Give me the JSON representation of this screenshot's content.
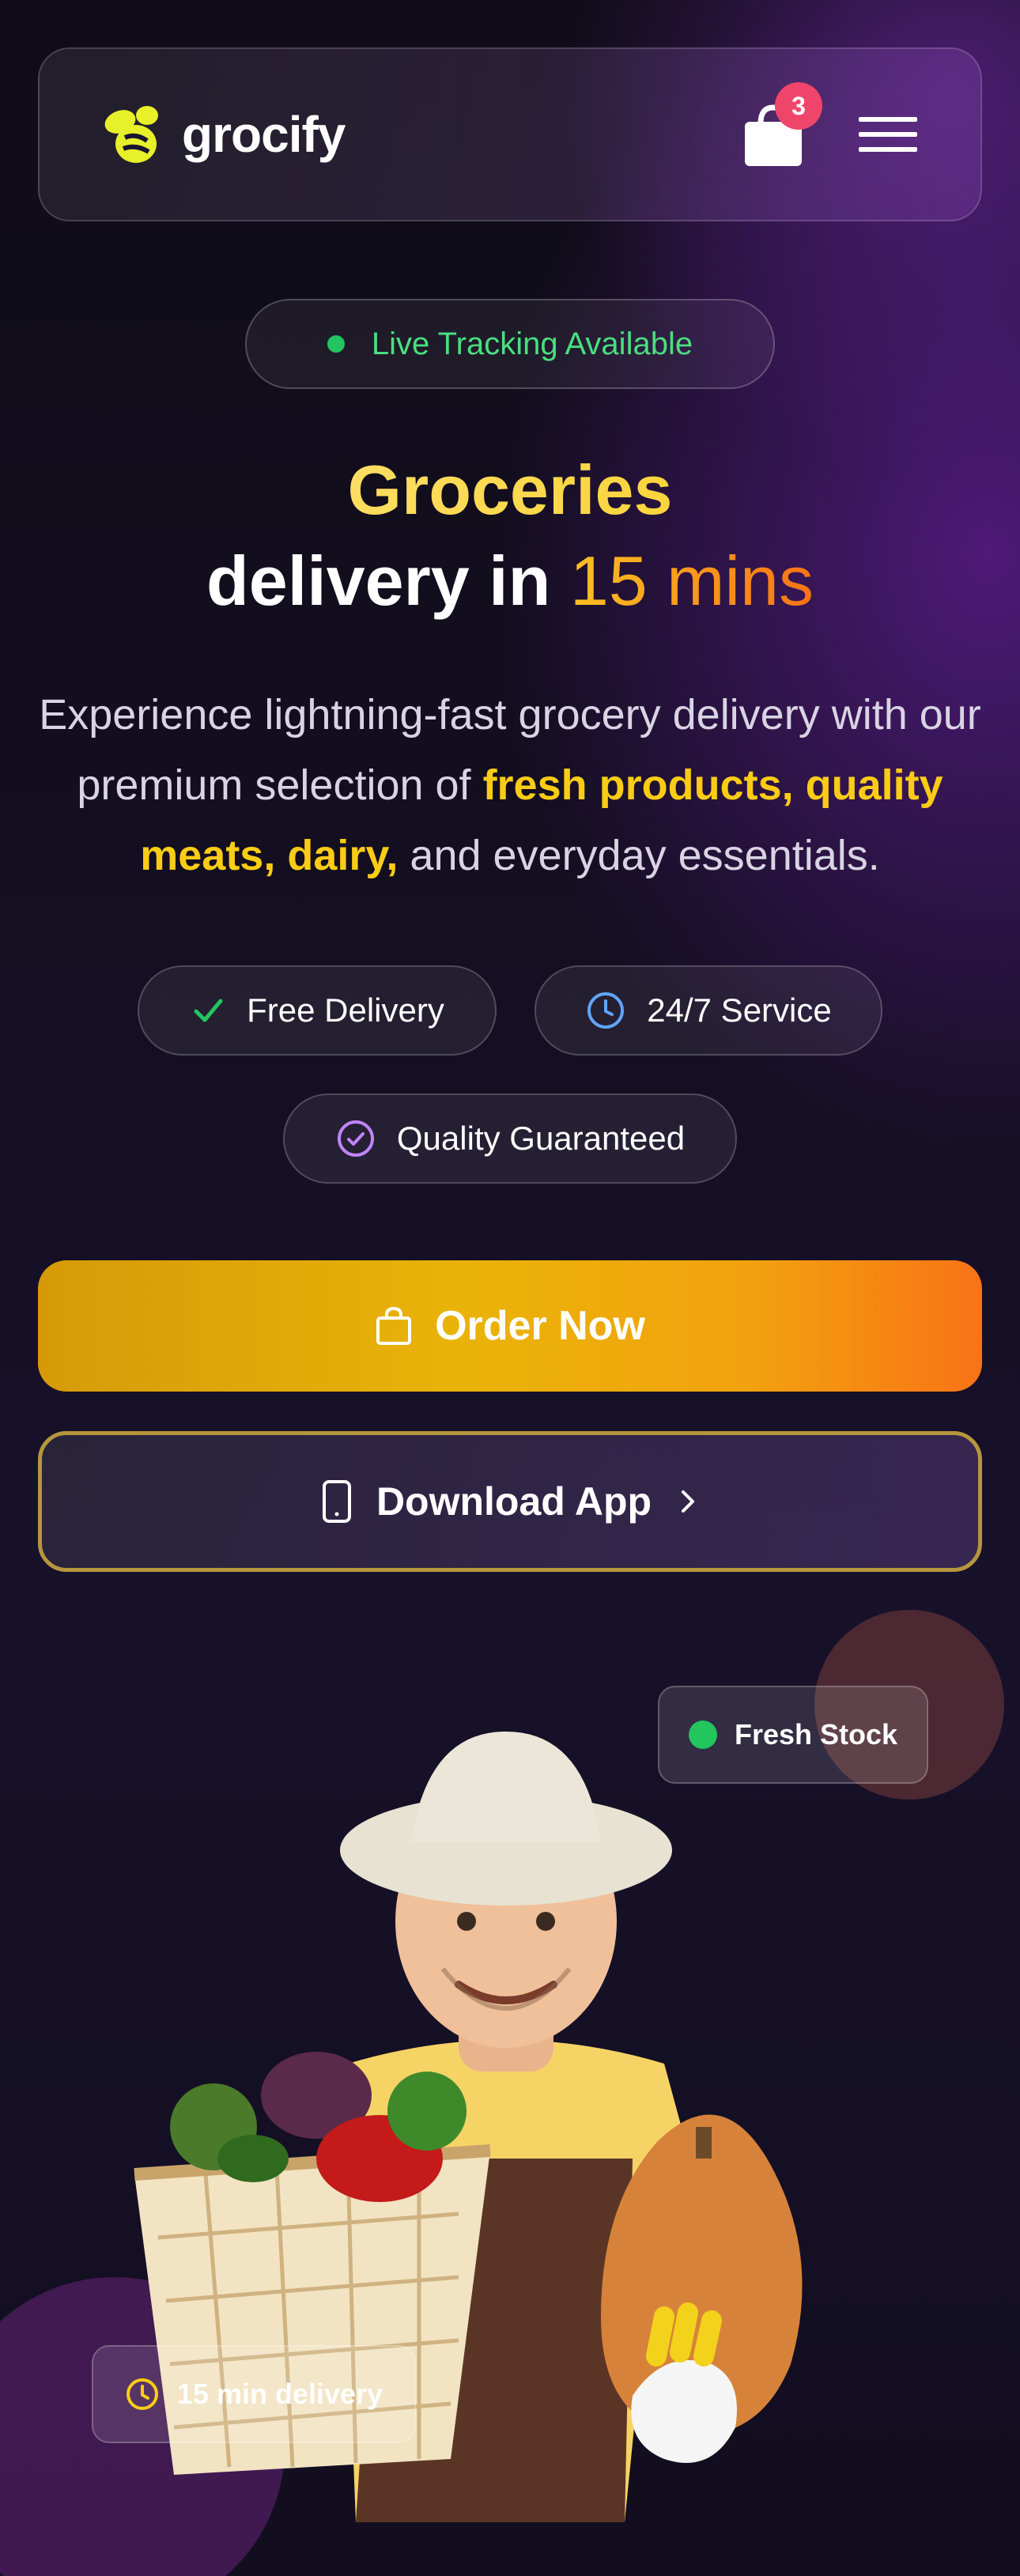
{
  "header": {
    "brand": "grocify",
    "cart_count": "3"
  },
  "hero": {
    "tracking_pill": "Live Tracking Available",
    "headline_line1": "Groceries",
    "headline_line2_prefix": "delivery in ",
    "headline_line2_accent": "15 mins",
    "description_part1": "Experience lightning-fast grocery delivery with our premium selection of ",
    "description_highlight": "fresh products, quality meats, dairy,",
    "description_part2": " and everyday essentials."
  },
  "features": [
    {
      "label": "Free Delivery",
      "icon": "check-icon",
      "color": "#22c55e"
    },
    {
      "label": "24/7 Service",
      "icon": "clock-icon",
      "color": "#60a5fa"
    },
    {
      "label": "Quality Guaranteed",
      "icon": "check-circle-icon",
      "color": "#c084fc"
    }
  ],
  "actions": {
    "order_label": "Order Now",
    "download_label": "Download App"
  },
  "badges": {
    "fresh_stock": "Fresh Stock",
    "delivery_time": "15 min delivery"
  },
  "colors": {
    "accent_yellow": "#facc15",
    "accent_orange": "#f97316",
    "badge_red": "#f0456b",
    "success_green": "#22c55e"
  }
}
